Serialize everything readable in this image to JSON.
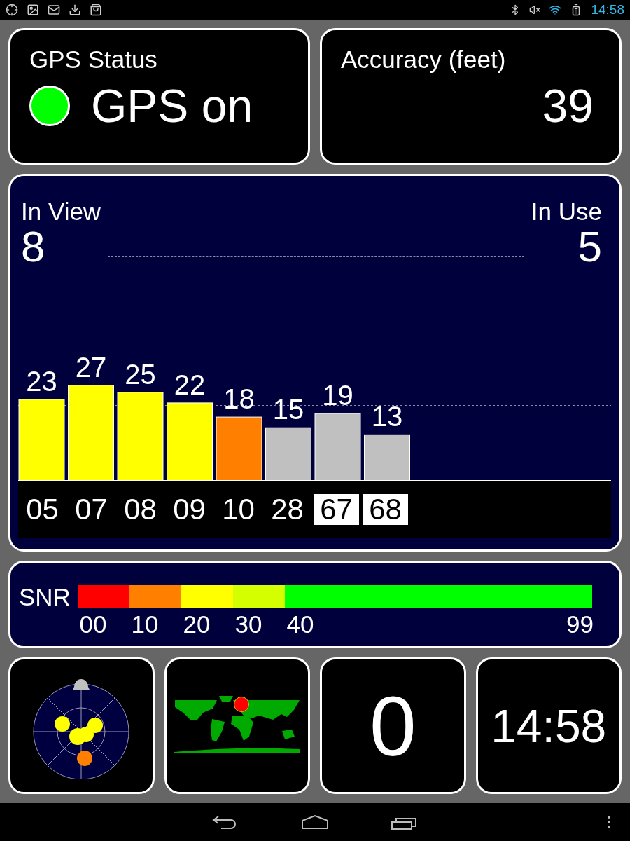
{
  "status_bar": {
    "time": "14:58"
  },
  "gps_status": {
    "title": "GPS Status",
    "value": "GPS on",
    "on": true
  },
  "accuracy": {
    "title": "Accuracy (feet)",
    "value": "39"
  },
  "satellites_panel": {
    "in_view_label": "In View",
    "in_view": "8",
    "in_use_label": "In Use",
    "in_use": "5",
    "satellites": [
      {
        "in_use": true,
        "kind": "gps"
      },
      {
        "in_use": true,
        "kind": "gps"
      },
      {
        "in_use": true,
        "kind": "gps"
      },
      {
        "in_use": true,
        "kind": "gps"
      },
      {
        "in_use": true,
        "kind": "gps"
      },
      {
        "in_use": false,
        "kind": "gps"
      },
      {
        "in_use": false,
        "kind": "glonass"
      },
      {
        "in_use": false,
        "kind": "glonass"
      }
    ],
    "chart_data": {
      "type": "bar",
      "categories": [
        "05",
        "07",
        "08",
        "09",
        "10",
        "28",
        "67",
        "68"
      ],
      "values": [
        23,
        27,
        25,
        22,
        18,
        15,
        19,
        13
      ],
      "data_labels": true
    }
  },
  "snr_scale": {
    "label": "SNR",
    "segments": [
      {
        "label": "00",
        "color": "#ff0000"
      },
      {
        "label": "10",
        "color": "#ff8000"
      },
      {
        "label": "20",
        "color": "#ffff00"
      },
      {
        "label": "30",
        "color": "#d4ff00"
      },
      {
        "label": "40",
        "color": "#00ff00"
      }
    ],
    "end_label": "99"
  },
  "tiles": {
    "count": "0",
    "clock": "14:58"
  }
}
